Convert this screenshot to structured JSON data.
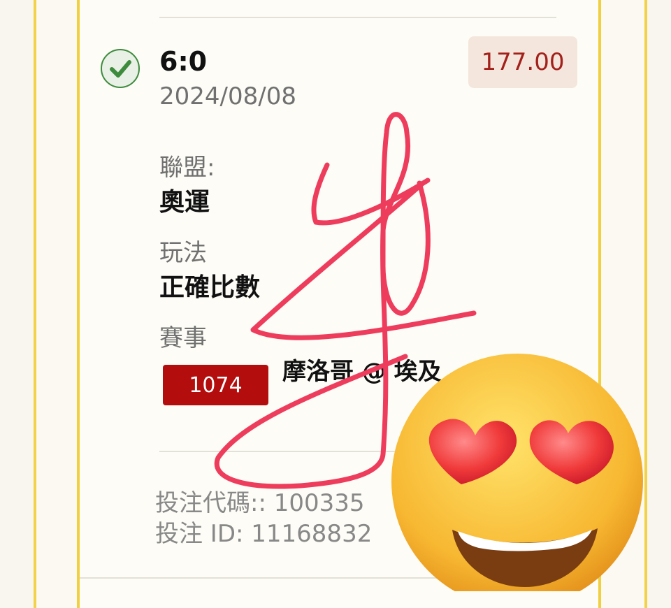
{
  "bet": {
    "score": "6:0",
    "date": "2024/08/08",
    "amount": "177.00",
    "league_label": "聯盟:",
    "league_value": "奧運",
    "play_label": "玩法",
    "play_value": "正確比數",
    "event_label": "賽事",
    "event_number": "1074",
    "event_name": "摩洛哥 @ 埃及",
    "bet_code_line": "投注代碼:: 100335",
    "bet_id_line": "投注 ID: 11168832"
  },
  "icons": [
    "check-circle-icon",
    "heart-eyes-emoji-icon"
  ],
  "colors": {
    "frame_yellow": "#f1cf40",
    "amount_text": "#a3211b",
    "amount_bg": "#f4e6dc",
    "event_badge": "#b40d0d",
    "scribble": "#ee3c5c",
    "check_green": "#3d8b3d"
  }
}
